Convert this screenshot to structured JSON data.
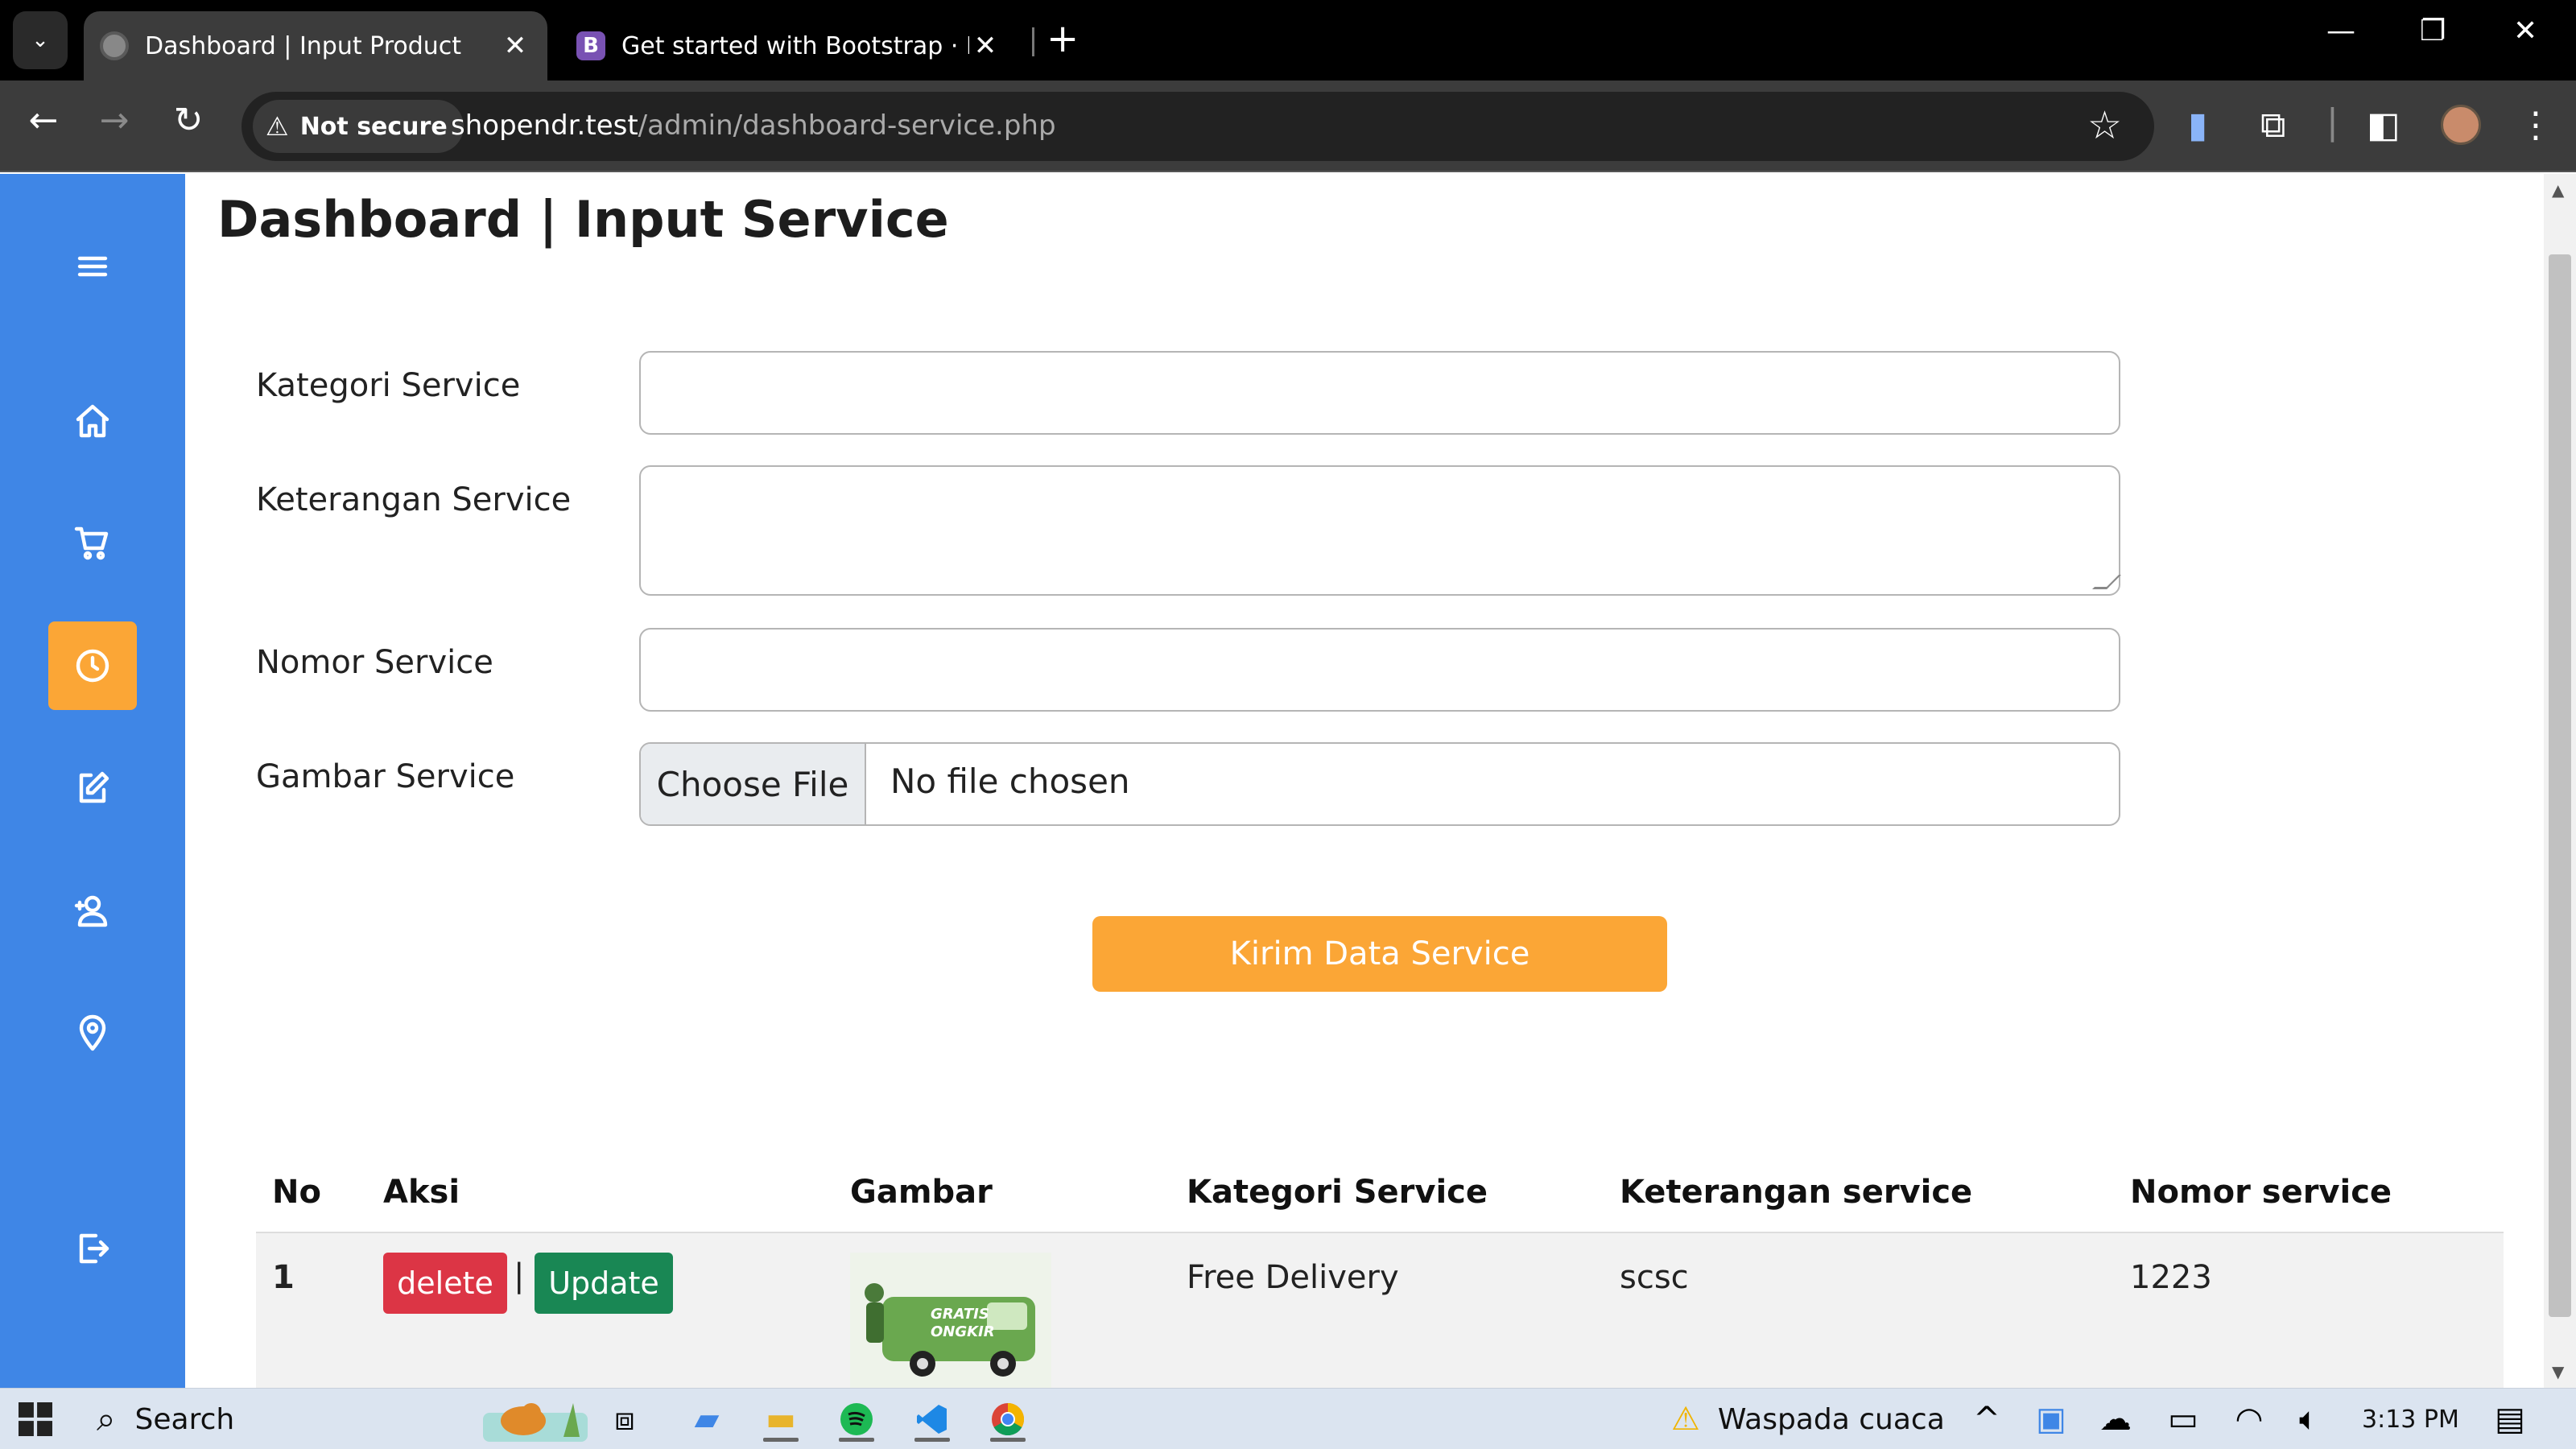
{
  "browser": {
    "tabs": [
      {
        "title": "Dashboard | Input Product",
        "active": true
      },
      {
        "title": "Get started with Bootstrap · Boo",
        "active": false
      }
    ],
    "bootstrap_favicon_letter": "B",
    "security_label": "Not secure",
    "url_host": "shopendr.test",
    "url_path": "/admin/dashboard-service.php"
  },
  "sidebar": {
    "accent_color": "#3f86e6",
    "active_color": "#fba636",
    "items": [
      "menu-icon",
      "home-icon",
      "cart-icon",
      "clock-icon",
      "edit-icon",
      "add-user-icon",
      "location-icon",
      "logout-icon"
    ]
  },
  "page": {
    "title": "Dashboard | Input Service",
    "form": {
      "kategori_label": "Kategori Service",
      "keterangan_label": "Keterangan Service",
      "nomor_label": "Nomor Service",
      "gambar_label": "Gambar Service",
      "file_button": "Choose File",
      "file_status": "No file chosen",
      "submit_label": "Kirim Data Service"
    },
    "table": {
      "headers": [
        "No",
        "Aksi",
        "Gambar",
        "Kategori Service",
        "Keterangan service",
        "Nomor service"
      ],
      "rows": [
        {
          "no": "1",
          "delete_label": "delete",
          "separator": "|",
          "update_label": "Update",
          "kategori": "Free Delivery",
          "keterangan": "scsc",
          "nomor": "1223",
          "image_text_1": "GRATIS",
          "image_text_2": "ONGKIR"
        }
      ]
    }
  },
  "taskbar": {
    "search_label": "Search",
    "weather_label": "Waspada cuaca",
    "time": "3:13 PM"
  }
}
